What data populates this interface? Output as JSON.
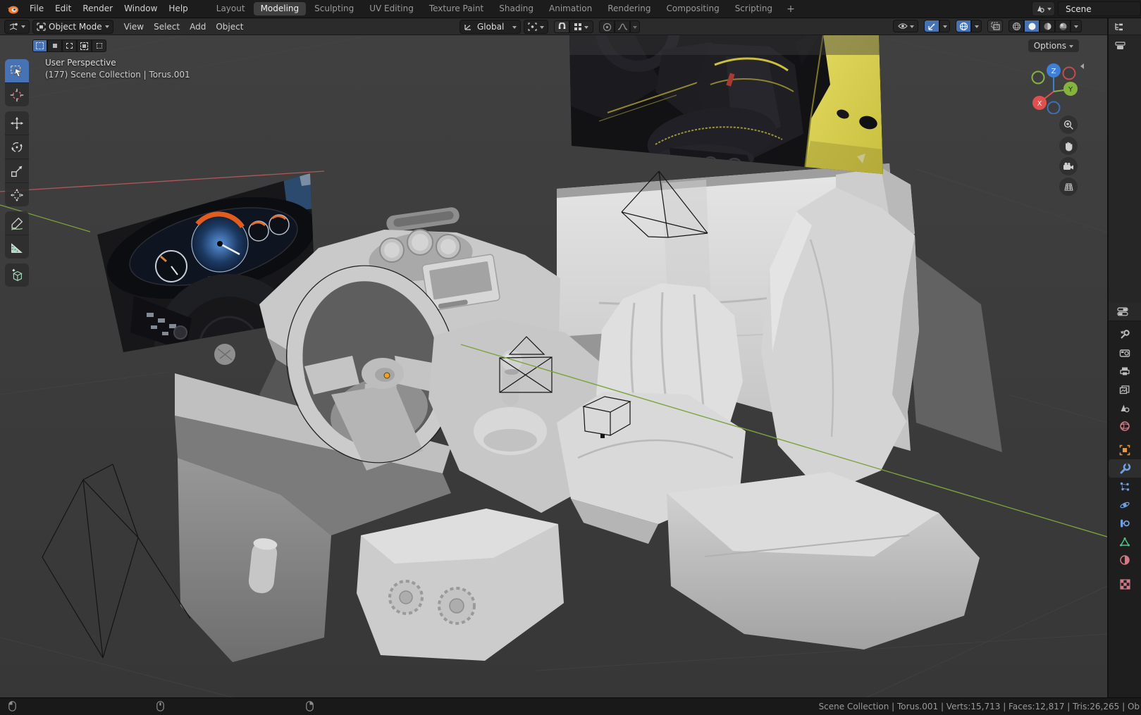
{
  "topbar": {
    "logo_icon": "blender-logo-icon",
    "menus": [
      "File",
      "Edit",
      "Render",
      "Window",
      "Help"
    ],
    "workspace_tabs": [
      "Layout",
      "Modeling",
      "Sculpting",
      "UV Editing",
      "Texture Paint",
      "Shading",
      "Animation",
      "Rendering",
      "Compositing",
      "Scripting"
    ],
    "active_tab": "Modeling",
    "add_workspace_label": "+",
    "scene_selector": {
      "icon": "scene-new-icon",
      "value": "Scene"
    }
  },
  "viewport_header": {
    "editor_type_icon": "editor-3d-viewport-icon",
    "mode": {
      "icon": "object-mode-icon",
      "label": "Object Mode"
    },
    "menus": [
      "View",
      "Select",
      "Add",
      "Object"
    ],
    "transform_orientation": {
      "icon": "orientation-axes-icon",
      "label": "Global"
    },
    "pivot_icon": "pivot-point-icon",
    "snap_icons": [
      "magnet-icon",
      "snap-increment-icon"
    ],
    "proportional_icons": [
      "proportional-edit-icon",
      "falloff-curve-icon"
    ],
    "right_icons": [
      "visibility-eye-icon",
      "gizmo-icon",
      "overlays-icon",
      "xray-icon"
    ],
    "shading_modes": [
      "wireframe",
      "solid",
      "material-preview",
      "rendered"
    ],
    "active_shading": "solid",
    "options_label": "Options"
  },
  "toolbar": {
    "tools": [
      "select-box",
      "cursor",
      "move",
      "rotate",
      "scale",
      "transform",
      "annotate",
      "measure",
      "add-cube"
    ],
    "active_tool": "select-box"
  },
  "select_modes": [
    "set",
    "extend",
    "subtract",
    "invert",
    "intersect"
  ],
  "viewport": {
    "view_label": "User Perspective",
    "context_label": "(177) Scene Collection | Torus.001"
  },
  "nav_gizmo": {
    "axis_x": "X",
    "axis_y": "Y",
    "axis_z": "Z",
    "colors": {
      "x": "#e0504e",
      "y": "#84b33e",
      "z": "#3f7fd6"
    },
    "view_tools": [
      "zoom-icon",
      "pan-hand-icon",
      "camera-view-icon",
      "ortho-grid-icon"
    ]
  },
  "outliner": {
    "editor_icon": "outliner-icon",
    "row_icon": "collection-filter-icon"
  },
  "properties": {
    "editor_icon": "properties-icon",
    "active_tab": "modifiers",
    "tabs": [
      {
        "name": "tool",
        "color": "#bdbdbd"
      },
      {
        "name": "render",
        "color": "#bdbdbd"
      },
      {
        "name": "output",
        "color": "#bdbdbd"
      },
      {
        "name": "view-layer",
        "color": "#bdbdbd"
      },
      {
        "name": "scene",
        "color": "#bdbdbd"
      },
      {
        "name": "world",
        "color": "#d07a88"
      },
      {
        "name": "object",
        "color": "#e8963f"
      },
      {
        "name": "modifiers",
        "color": "#6e9fe0"
      },
      {
        "name": "particles",
        "color": "#6e9fe0"
      },
      {
        "name": "physics",
        "color": "#6e9fe0"
      },
      {
        "name": "constraints",
        "color": "#6e9fe0"
      },
      {
        "name": "object-data",
        "color": "#53c08a"
      },
      {
        "name": "material",
        "color": "#d07a88"
      },
      {
        "name": "texture",
        "color": "#d07a88"
      }
    ]
  },
  "statusbar": {
    "mouse_hints": [
      "left-click-icon",
      "middle-click-icon",
      "right-click-icon"
    ],
    "stats": "Scene Collection | Torus.001 | Verts:15,713 | Faces:12,817 | Tris:26,265 | Ob"
  },
  "scene": {
    "selected_object": "Torus.001",
    "axis_colors": {
      "x": "#b0575a",
      "y": "#7aa33c"
    },
    "reference_images": [
      "instrument-cluster-photo",
      "car-seat-photo"
    ]
  }
}
